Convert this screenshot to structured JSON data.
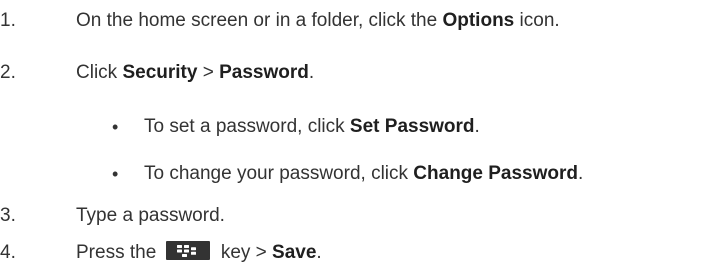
{
  "steps": [
    {
      "number": "1.",
      "before": "On the home screen or in a folder, click the ",
      "bold": "Options",
      "after": " icon."
    },
    {
      "number": "2.",
      "before": "Click ",
      "bold1": "Security",
      "sep": " > ",
      "bold2": "Password",
      "after": "."
    },
    {
      "number": "3.",
      "text": "Type a password."
    },
    {
      "number": "4.",
      "before": "Press the ",
      "key_icon": "blackberry-menu-key-icon",
      "middle": " key > ",
      "bold": "Save",
      "after": "."
    }
  ],
  "bullets": [
    {
      "symbol": "•",
      "before": "To set a password, click ",
      "bold": "Set Password",
      "after": "."
    },
    {
      "symbol": "•",
      "before": "To change your password, click ",
      "bold": "Change Password",
      "after": "."
    }
  ],
  "colors": {
    "text": "#333333",
    "key_background": "#333333",
    "key_glyph": "#ffffff"
  }
}
